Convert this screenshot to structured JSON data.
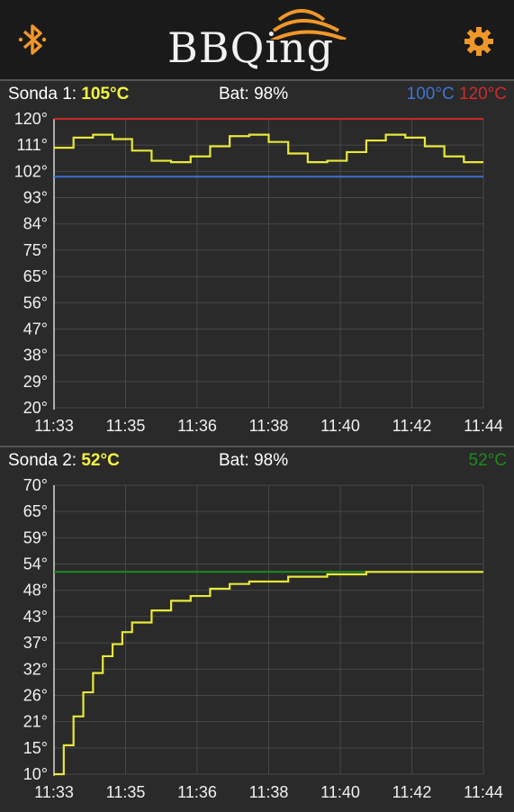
{
  "app": {
    "logo_text": "BBQing",
    "icons": {
      "bluetooth": "bluetooth-icon",
      "settings": "gear-icon"
    },
    "accent_color": "#f0972a"
  },
  "probe1": {
    "label": "Sonda 1: ",
    "value": "105°C",
    "battery": "Bat: 98%",
    "low_limit": "100°C",
    "high_limit": "120°C"
  },
  "probe2": {
    "label": "Sonda 2: ",
    "value": "52°C",
    "battery": "Bat: 98%",
    "target": "52°C"
  },
  "chart_data": [
    {
      "type": "line",
      "title": "Sonda 1: 105°C",
      "x_ticks": [
        "11:33",
        "11:35",
        "11:36",
        "11:38",
        "11:40",
        "11:42",
        "11:44"
      ],
      "y_ticks": [
        "120°",
        "111°",
        "102°",
        "93°",
        "84°",
        "75°",
        "65°",
        "56°",
        "47°",
        "38°",
        "29°",
        "20°"
      ],
      "ylim": [
        20,
        120
      ],
      "reference_lines": [
        {
          "value": 120,
          "color": "#c62a2a"
        },
        {
          "value": 100,
          "color": "#3a6fd3"
        }
      ],
      "series_color": "#e8e83a",
      "series": [
        {
          "x": [
            0,
            0.5,
            1,
            1.5,
            2,
            2.5,
            3,
            3.5,
            4,
            4.5,
            5,
            5.5,
            6,
            6.5,
            7,
            7.5,
            8,
            8.5,
            9,
            9.5,
            10,
            10.5,
            11
          ],
          "y": [
            110,
            113.5,
            114.5,
            113,
            109,
            105.5,
            105,
            107,
            110.5,
            114,
            114.5,
            112,
            108,
            105,
            105.5,
            108.5,
            112.5,
            114.5,
            113.5,
            110.5,
            107,
            105,
            105
          ]
        }
      ]
    },
    {
      "type": "line",
      "title": "Sonda 2: 52°C",
      "x_ticks": [
        "11:33",
        "11:35",
        "11:36",
        "11:38",
        "11:40",
        "11:42",
        "11:44"
      ],
      "y_ticks": [
        "70°",
        "65°",
        "59°",
        "54°",
        "48°",
        "43°",
        "37°",
        "32°",
        "26°",
        "21°",
        "15°",
        "10°"
      ],
      "ylim": [
        10,
        70
      ],
      "reference_lines": [
        {
          "value": 52,
          "color": "#1f8a1f"
        }
      ],
      "series_color": "#e8e83a",
      "series": [
        {
          "x": [
            0,
            0.25,
            0.5,
            0.75,
            1,
            1.25,
            1.5,
            1.75,
            2,
            2.5,
            3,
            3.5,
            4,
            4.5,
            5,
            6,
            7,
            8,
            9,
            10,
            11
          ],
          "y": [
            10,
            16,
            22,
            27,
            31,
            34.5,
            37,
            39.5,
            41.5,
            44,
            46,
            47,
            48.5,
            49.5,
            50,
            51,
            51.5,
            52,
            52,
            52,
            52
          ]
        }
      ]
    }
  ]
}
